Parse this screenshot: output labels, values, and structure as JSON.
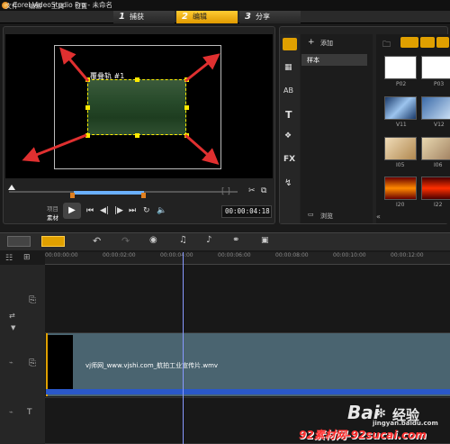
{
  "window": {
    "title": "Corel VideoStudio Pro - 未命名"
  },
  "menu": [
    "文件",
    "编辑",
    "工具",
    "设置"
  ],
  "steps": [
    {
      "num": "1",
      "label": "捕获"
    },
    {
      "num": "2",
      "label": "编辑"
    },
    {
      "num": "3",
      "label": "分享"
    }
  ],
  "preview": {
    "clip_title": "覆叠轨 #1",
    "mode_labels": {
      "project": "项目",
      "clip": "素材"
    },
    "timecode": "00:00:04:18"
  },
  "library": {
    "add_label": "添加",
    "folder_label": "样本",
    "browse_label": "浏览",
    "thumbs": [
      "P02",
      "P03",
      "V11",
      "V12",
      "I05",
      "I06",
      "I20",
      "I22"
    ]
  },
  "timeline": {
    "ruler": [
      "00:00:00:00",
      "00:00:02:00",
      "00:00:04:00",
      "00:00:06:00",
      "00:00:08:00",
      "00:00:10:00",
      "00:00:12:00"
    ],
    "clip_name": "vj师网_www.vjshi.com_航拍工业宣传片.wmv"
  },
  "watermark": {
    "baidu": "Bai",
    "baidu2": "经验",
    "baidu_url": "jingyan.baidu.com",
    "site": "92素材网-92sucai.com"
  },
  "colors": {
    "accent": "#ffb300",
    "selection": "#ffea00",
    "arrow": "#e03030",
    "clip": "#4a6470"
  }
}
